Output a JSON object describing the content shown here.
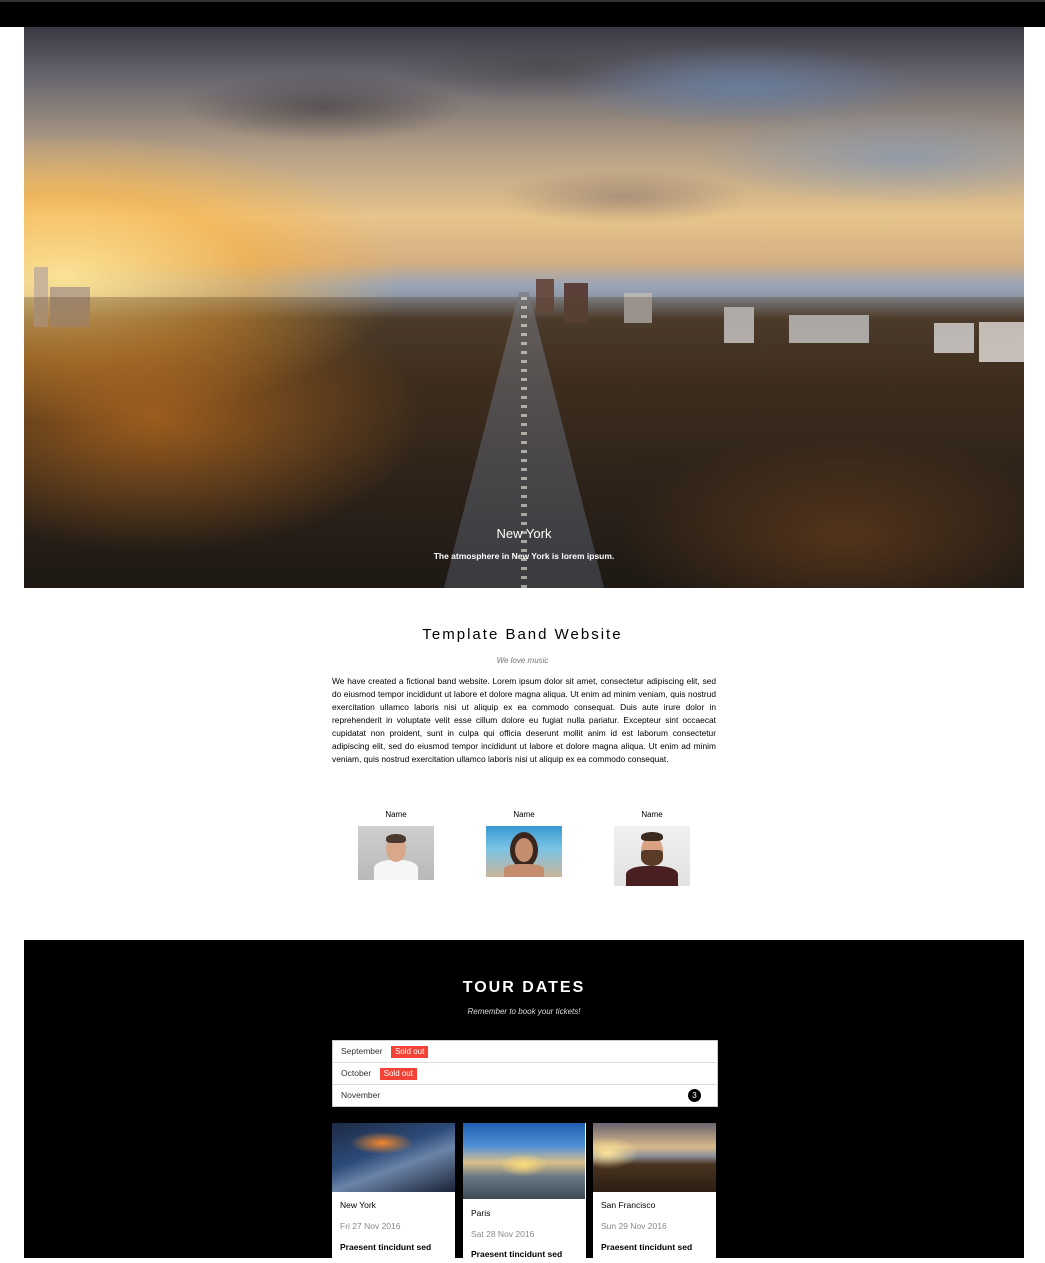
{
  "hero": {
    "title": "New York",
    "subtitle": "The atmosphere in New York is lorem ipsum."
  },
  "about": {
    "title": "Template Band Website",
    "subtitle": "We love music",
    "text": "We have created a fictional band website. Lorem ipsum dolor sit amet, consectetur adipiscing elit, sed do eiusmod tempor incididunt ut labore et dolore magna aliqua. Ut enim ad minim veniam, quis nostrud exercitation ullamco laboris nisi ut aliquip ex ea commodo consequat. Duis aute irure dolor in reprehenderit in voluptate velit esse cillum dolore eu fugiat nulla pariatur. Excepteur sint occaecat cupidatat non proident, sunt in culpa qui officia deserunt mollit anim id est laborum consectetur adipiscing elit, sed do eiusmod tempor incididunt ut labore et dolore magna aliqua. Ut enim ad minim veniam, quis nostrud exercitation ullamco laboris nisi ut aliquip ex ea commodo consequat.",
    "members": [
      {
        "name": "Name"
      },
      {
        "name": "Name"
      },
      {
        "name": "Name"
      }
    ]
  },
  "tour": {
    "title": "TOUR DATES",
    "subtitle": "Remember to book your tickets!",
    "months": [
      {
        "label": "September",
        "badge": "Sold out"
      },
      {
        "label": "October",
        "badge": "Sold out"
      },
      {
        "label": "November",
        "count": "3"
      }
    ],
    "cards": [
      {
        "city": "New York",
        "date": "Fri 27 Nov 2016",
        "text": "Praesent tincidunt sed"
      },
      {
        "city": "Paris",
        "date": "Sat 28 Nov 2016",
        "text": "Praesent tincidunt sed"
      },
      {
        "city": "San Francisco",
        "date": "Sun 29 Nov 2016",
        "text": "Praesent tincidunt sed"
      }
    ]
  },
  "colors": {
    "sold_out_badge": "#f44336",
    "tour_background": "#000000",
    "topbar": "#000000"
  }
}
